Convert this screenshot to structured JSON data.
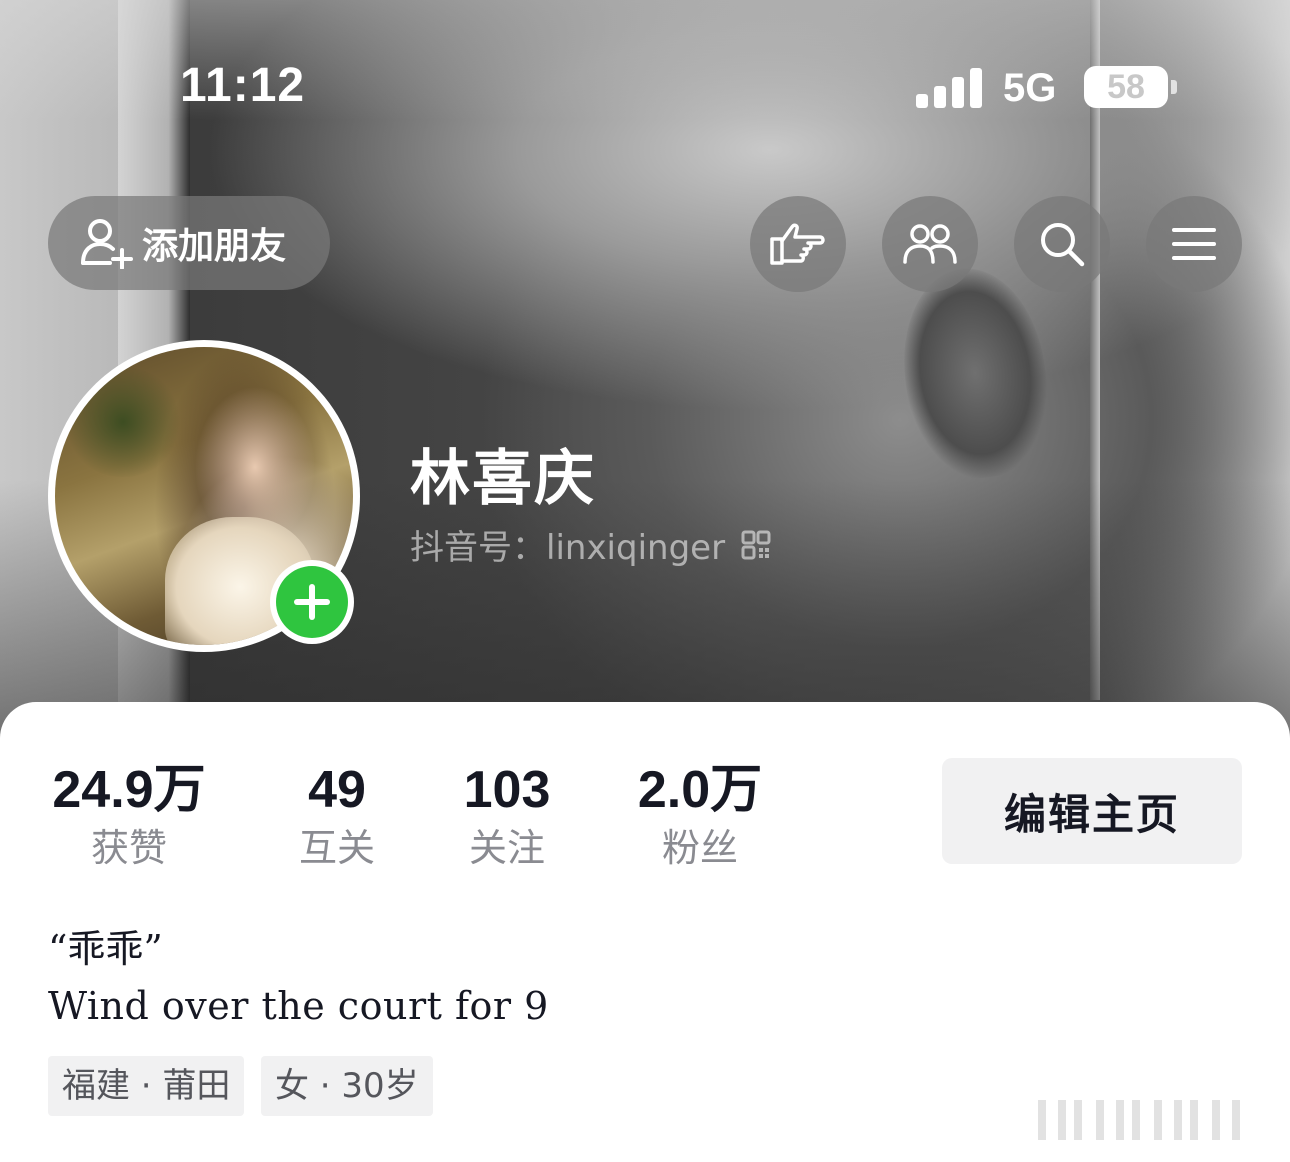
{
  "status_bar": {
    "time": "11:12",
    "network": "5G",
    "battery": "58"
  },
  "top_bar": {
    "add_friend_label": "添加朋友",
    "icons": [
      "pointing-hand-icon",
      "people-icon",
      "search-icon",
      "menu-icon"
    ]
  },
  "profile": {
    "nickname": "林喜庆",
    "douyin_id": "抖音号：linxiqinger"
  },
  "stats": [
    {
      "value": "24.9万",
      "label": "获赞"
    },
    {
      "value": "49",
      "label": "互关"
    },
    {
      "value": "103",
      "label": "关注"
    },
    {
      "value": "2.0万",
      "label": "粉丝"
    }
  ],
  "edit_button_label": "编辑主页",
  "bio": {
    "title": "“乖乖”",
    "line": "Wind over the court for 9"
  },
  "tags": [
    "福建 · 莆田",
    "女 · 30岁"
  ],
  "colors": {
    "accent_green": "#2fc53f",
    "text_primary": "#161823",
    "text_secondary": "#8a8b91",
    "button_bg": "#f1f1f2"
  }
}
